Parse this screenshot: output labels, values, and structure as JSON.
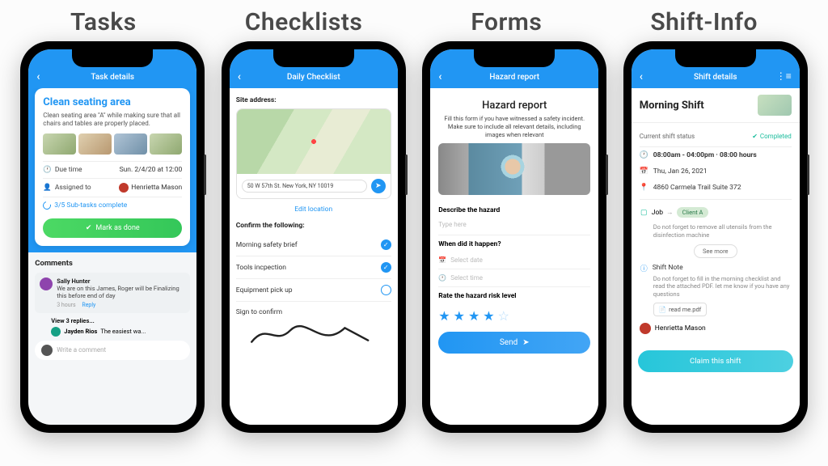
{
  "columns": [
    "Tasks",
    "Checklists",
    "Forms",
    "Shift-Info"
  ],
  "tasks": {
    "header": "Task details",
    "title": "Clean seating area",
    "desc": "Clean seating area \"A\" while making sure that all chairs and tables are properly placed.",
    "due_label": "Due time",
    "due_value": "Sun. 2/4/20 at 12:00",
    "assigned_label": "Assigned to",
    "assigned_value": "Henrietta Mason",
    "subtasks": "3/5 Sub-tasks complete",
    "done_btn": "Mark as done",
    "comments_h": "Comments",
    "comment1_author": "Sally Hunter",
    "comment1_body": "We are on this James, Roger will be Finalizing  this before end of day",
    "comment1_time": "3 hours",
    "reply": "Reply",
    "view_replies": "View 3 replies...",
    "comment2_author": "Jayden Rios",
    "comment2_body": "The easiest wa...",
    "write_placeholder": "Write a comment"
  },
  "checklist": {
    "header": "Daily Checklist",
    "site_label": "Site address:",
    "address": "50 W 57th St. New York, NY 10019",
    "edit_location": "Edit location",
    "confirm_h": "Confirm the following:",
    "items": [
      {
        "label": "Morning safety brief",
        "checked": true
      },
      {
        "label": "Tools incpection",
        "checked": true
      },
      {
        "label": "Equipment pick up",
        "checked": false
      }
    ],
    "sign": "Sign to confirm"
  },
  "form": {
    "header": "Hazard report",
    "title": "Hazard report",
    "subtitle": "Fill this form if you have witnessed a safety incident. Make sure to include all relevant details, including images when relevant",
    "describe_h": "Describe the  hazard",
    "describe_ph": "Type here",
    "when_h": "When did it happen?",
    "date_ph": "Select date",
    "time_ph": "Select time",
    "rate_h": "Rate the hazard risk level",
    "rating": 4,
    "send": "Send"
  },
  "shift": {
    "header": "Shift details",
    "title": "Morning Shift",
    "status_label": "Current shift status",
    "status_value": "Completed",
    "time": "08:00am - 04:00pm · 08:00 hours",
    "date": "Thu, Jan 26, 2021",
    "location": "4860 Carmela Trail Suite 372",
    "job_label": "Job",
    "job_value": "Client A",
    "job_note": "Do not forget to remove all utensils from the disinfection machine",
    "see_more": "See more",
    "note_h": "Shift Note",
    "note_body": "Do not forget to fill in the morning checklist and read the attached PDF. let me know if you have any questions",
    "attachment": "read me.pdf",
    "assignee": "Henrietta Mason",
    "claim": "Claim this shift"
  }
}
